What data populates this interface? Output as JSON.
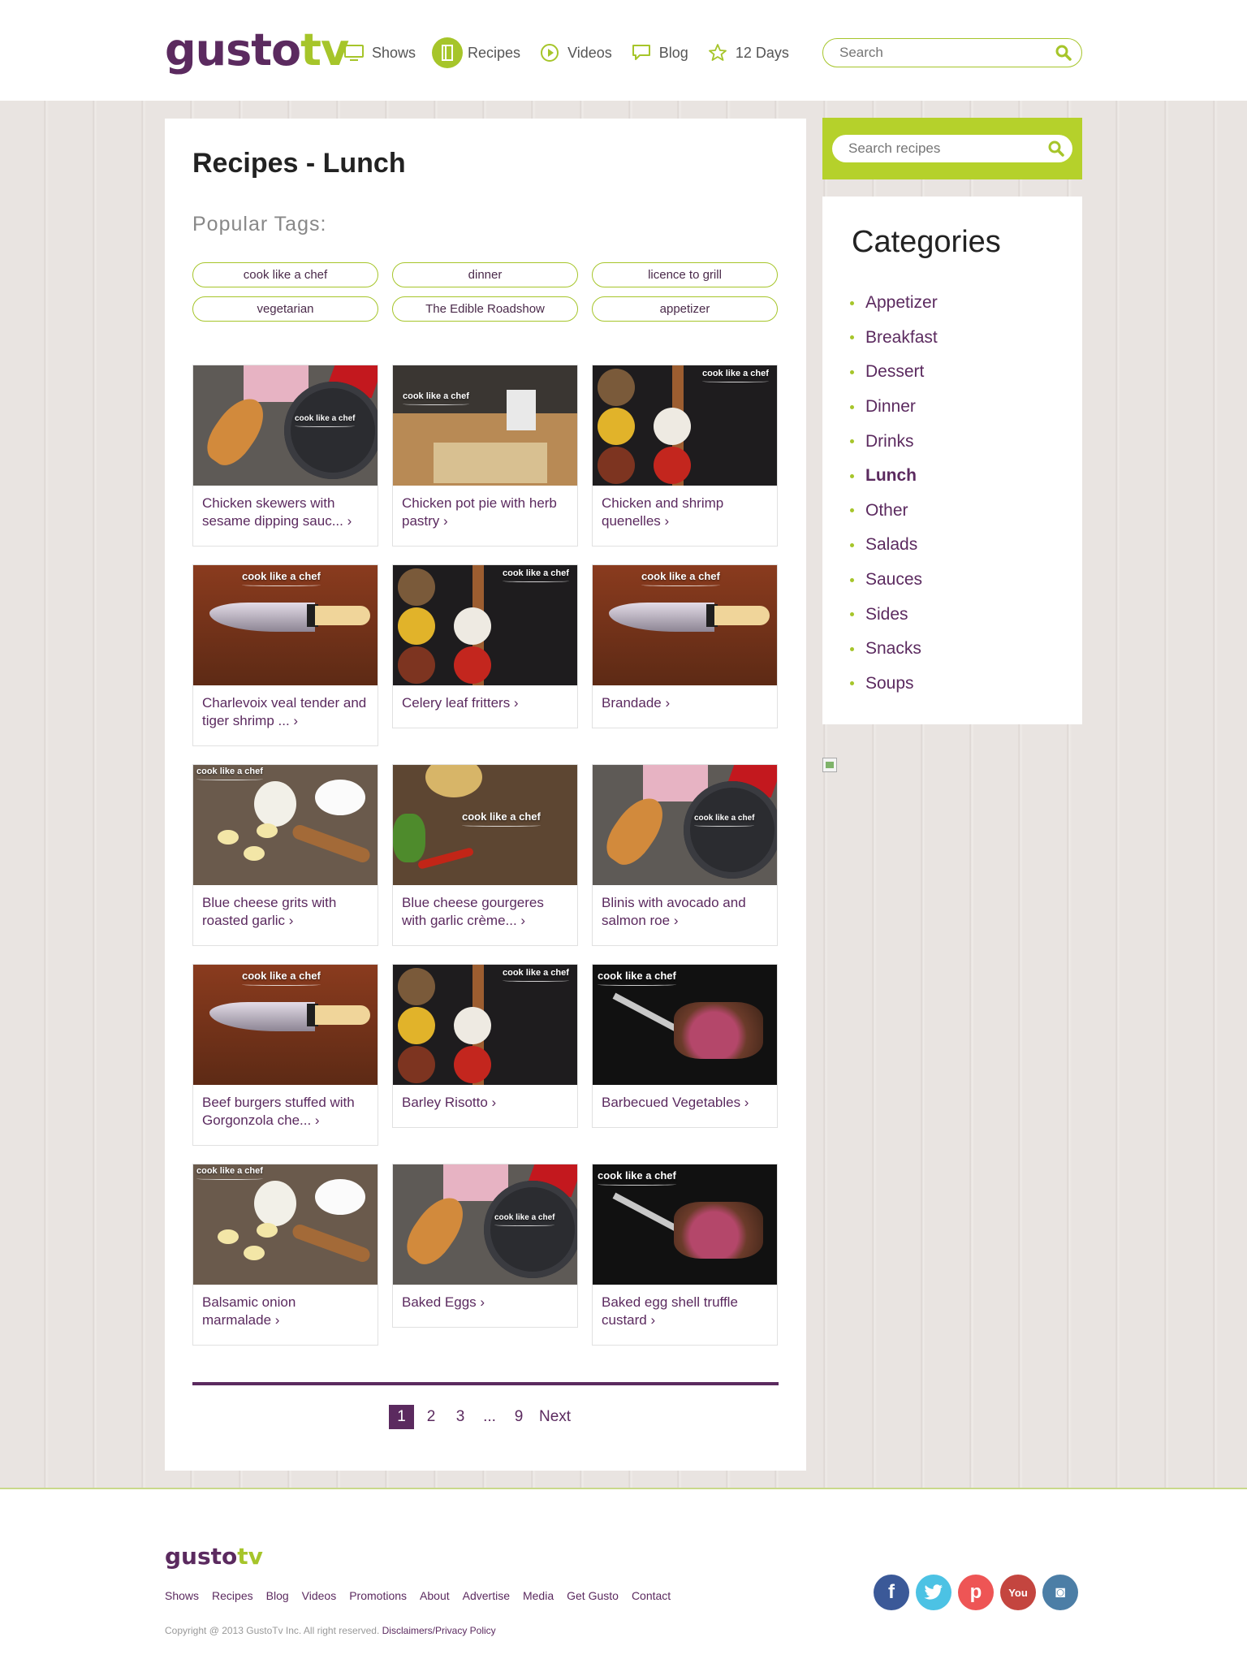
{
  "header": {
    "logo_main": "gusto",
    "logo_tv": "tv",
    "nav": [
      {
        "label": "Shows",
        "icon": "tv-icon"
      },
      {
        "label": "Recipes",
        "icon": "recipe-book-icon",
        "active": true
      },
      {
        "label": "Videos",
        "icon": "play-icon"
      },
      {
        "label": "Blog",
        "icon": "speech-bubble-icon"
      },
      {
        "label": "12 Days",
        "icon": "star-icon"
      }
    ],
    "search_placeholder": "Search"
  },
  "main": {
    "title_bold": "Recipes",
    "title_rest": " - Lunch",
    "tags_title": "Popular Tags:",
    "tags": [
      "cook like a chef",
      "dinner",
      "licence to grill",
      "vegetarian",
      "The Edible Roadshow",
      "appetizer"
    ],
    "watermark": "cook like a chef",
    "recipes": [
      {
        "title": "Chicken skewers with sesame dipping sauc... ›"
      },
      {
        "title": "Chicken pot pie with herb pastry ›"
      },
      {
        "title": "Chicken and shrimp quenelles ›"
      },
      {
        "title": "Charlevoix veal tender and tiger shrimp ... ›"
      },
      {
        "title": "Celery leaf fritters ›"
      },
      {
        "title": "Brandade ›"
      },
      {
        "title": "Blue cheese grits with roasted garlic ›"
      },
      {
        "title": "Blue cheese gourgeres with garlic crème... ›"
      },
      {
        "title": "Blinis with avocado and salmon roe ›"
      },
      {
        "title": "Beef burgers stuffed with Gorgonzola che... ›"
      },
      {
        "title": "Barley Risotto ›"
      },
      {
        "title": "Barbecued Vegetables ›"
      },
      {
        "title": "Balsamic onion marmalade ›"
      },
      {
        "title": "Baked Eggs ›"
      },
      {
        "title": "Baked egg shell truffle custard ›"
      }
    ],
    "pagination": {
      "current": "1",
      "pages": [
        "2",
        "3"
      ],
      "ellipsis": "...",
      "last": "9",
      "next": "Next"
    }
  },
  "sidebar": {
    "search_placeholder": "Search recipes",
    "categories_title": "Categories",
    "categories": [
      "Appetizer",
      "Breakfast",
      "Dessert",
      "Dinner",
      "Drinks",
      "Lunch",
      "Other",
      "Salads",
      "Sauces",
      "Sides",
      "Snacks",
      "Soups"
    ],
    "active_category": "Lunch"
  },
  "footer": {
    "logo_main": "gusto",
    "logo_tv": "tv",
    "links": [
      "Shows",
      "Recipes",
      "Blog",
      "Videos",
      "Promotions",
      "About",
      "Advertise",
      "Media",
      "Get Gusto",
      "Contact"
    ],
    "copyright": "Copyright @ 2013 GustoTv Inc. All right reserved. ",
    "policy_link": "Disclaimers/Privacy Policy",
    "social": [
      {
        "name": "facebook-icon",
        "glyph": "f",
        "color": "#3b5998"
      },
      {
        "name": "twitter-icon",
        "glyph": "t",
        "color": "#4cc2e4"
      },
      {
        "name": "pinterest-icon",
        "glyph": "p",
        "color": "#ee5555"
      },
      {
        "name": "youtube-icon",
        "glyph": "You",
        "color": "#c4453f"
      },
      {
        "name": "instagram-icon",
        "glyph": "◙",
        "color": "#4c7ea6"
      }
    ]
  },
  "colors": {
    "brand_purple": "#5b2a5f",
    "brand_green": "#a6c52a"
  }
}
